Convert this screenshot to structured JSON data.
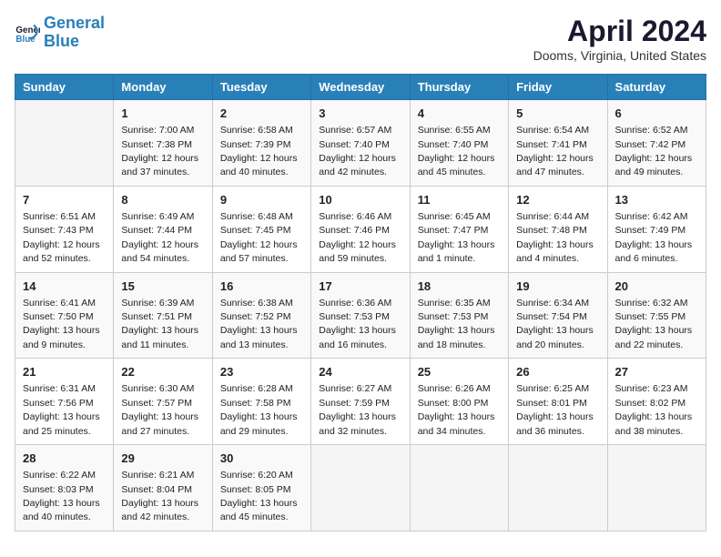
{
  "header": {
    "logo_line1": "General",
    "logo_line2": "Blue",
    "title": "April 2024",
    "subtitle": "Dooms, Virginia, United States"
  },
  "days_of_week": [
    "Sunday",
    "Monday",
    "Tuesday",
    "Wednesday",
    "Thursday",
    "Friday",
    "Saturday"
  ],
  "weeks": [
    [
      {
        "num": "",
        "detail": ""
      },
      {
        "num": "1",
        "detail": "Sunrise: 7:00 AM\nSunset: 7:38 PM\nDaylight: 12 hours\nand 37 minutes."
      },
      {
        "num": "2",
        "detail": "Sunrise: 6:58 AM\nSunset: 7:39 PM\nDaylight: 12 hours\nand 40 minutes."
      },
      {
        "num": "3",
        "detail": "Sunrise: 6:57 AM\nSunset: 7:40 PM\nDaylight: 12 hours\nand 42 minutes."
      },
      {
        "num": "4",
        "detail": "Sunrise: 6:55 AM\nSunset: 7:40 PM\nDaylight: 12 hours\nand 45 minutes."
      },
      {
        "num": "5",
        "detail": "Sunrise: 6:54 AM\nSunset: 7:41 PM\nDaylight: 12 hours\nand 47 minutes."
      },
      {
        "num": "6",
        "detail": "Sunrise: 6:52 AM\nSunset: 7:42 PM\nDaylight: 12 hours\nand 49 minutes."
      }
    ],
    [
      {
        "num": "7",
        "detail": "Sunrise: 6:51 AM\nSunset: 7:43 PM\nDaylight: 12 hours\nand 52 minutes."
      },
      {
        "num": "8",
        "detail": "Sunrise: 6:49 AM\nSunset: 7:44 PM\nDaylight: 12 hours\nand 54 minutes."
      },
      {
        "num": "9",
        "detail": "Sunrise: 6:48 AM\nSunset: 7:45 PM\nDaylight: 12 hours\nand 57 minutes."
      },
      {
        "num": "10",
        "detail": "Sunrise: 6:46 AM\nSunset: 7:46 PM\nDaylight: 12 hours\nand 59 minutes."
      },
      {
        "num": "11",
        "detail": "Sunrise: 6:45 AM\nSunset: 7:47 PM\nDaylight: 13 hours\nand 1 minute."
      },
      {
        "num": "12",
        "detail": "Sunrise: 6:44 AM\nSunset: 7:48 PM\nDaylight: 13 hours\nand 4 minutes."
      },
      {
        "num": "13",
        "detail": "Sunrise: 6:42 AM\nSunset: 7:49 PM\nDaylight: 13 hours\nand 6 minutes."
      }
    ],
    [
      {
        "num": "14",
        "detail": "Sunrise: 6:41 AM\nSunset: 7:50 PM\nDaylight: 13 hours\nand 9 minutes."
      },
      {
        "num": "15",
        "detail": "Sunrise: 6:39 AM\nSunset: 7:51 PM\nDaylight: 13 hours\nand 11 minutes."
      },
      {
        "num": "16",
        "detail": "Sunrise: 6:38 AM\nSunset: 7:52 PM\nDaylight: 13 hours\nand 13 minutes."
      },
      {
        "num": "17",
        "detail": "Sunrise: 6:36 AM\nSunset: 7:53 PM\nDaylight: 13 hours\nand 16 minutes."
      },
      {
        "num": "18",
        "detail": "Sunrise: 6:35 AM\nSunset: 7:53 PM\nDaylight: 13 hours\nand 18 minutes."
      },
      {
        "num": "19",
        "detail": "Sunrise: 6:34 AM\nSunset: 7:54 PM\nDaylight: 13 hours\nand 20 minutes."
      },
      {
        "num": "20",
        "detail": "Sunrise: 6:32 AM\nSunset: 7:55 PM\nDaylight: 13 hours\nand 22 minutes."
      }
    ],
    [
      {
        "num": "21",
        "detail": "Sunrise: 6:31 AM\nSunset: 7:56 PM\nDaylight: 13 hours\nand 25 minutes."
      },
      {
        "num": "22",
        "detail": "Sunrise: 6:30 AM\nSunset: 7:57 PM\nDaylight: 13 hours\nand 27 minutes."
      },
      {
        "num": "23",
        "detail": "Sunrise: 6:28 AM\nSunset: 7:58 PM\nDaylight: 13 hours\nand 29 minutes."
      },
      {
        "num": "24",
        "detail": "Sunrise: 6:27 AM\nSunset: 7:59 PM\nDaylight: 13 hours\nand 32 minutes."
      },
      {
        "num": "25",
        "detail": "Sunrise: 6:26 AM\nSunset: 8:00 PM\nDaylight: 13 hours\nand 34 minutes."
      },
      {
        "num": "26",
        "detail": "Sunrise: 6:25 AM\nSunset: 8:01 PM\nDaylight: 13 hours\nand 36 minutes."
      },
      {
        "num": "27",
        "detail": "Sunrise: 6:23 AM\nSunset: 8:02 PM\nDaylight: 13 hours\nand 38 minutes."
      }
    ],
    [
      {
        "num": "28",
        "detail": "Sunrise: 6:22 AM\nSunset: 8:03 PM\nDaylight: 13 hours\nand 40 minutes."
      },
      {
        "num": "29",
        "detail": "Sunrise: 6:21 AM\nSunset: 8:04 PM\nDaylight: 13 hours\nand 42 minutes."
      },
      {
        "num": "30",
        "detail": "Sunrise: 6:20 AM\nSunset: 8:05 PM\nDaylight: 13 hours\nand 45 minutes."
      },
      {
        "num": "",
        "detail": ""
      },
      {
        "num": "",
        "detail": ""
      },
      {
        "num": "",
        "detail": ""
      },
      {
        "num": "",
        "detail": ""
      }
    ]
  ]
}
